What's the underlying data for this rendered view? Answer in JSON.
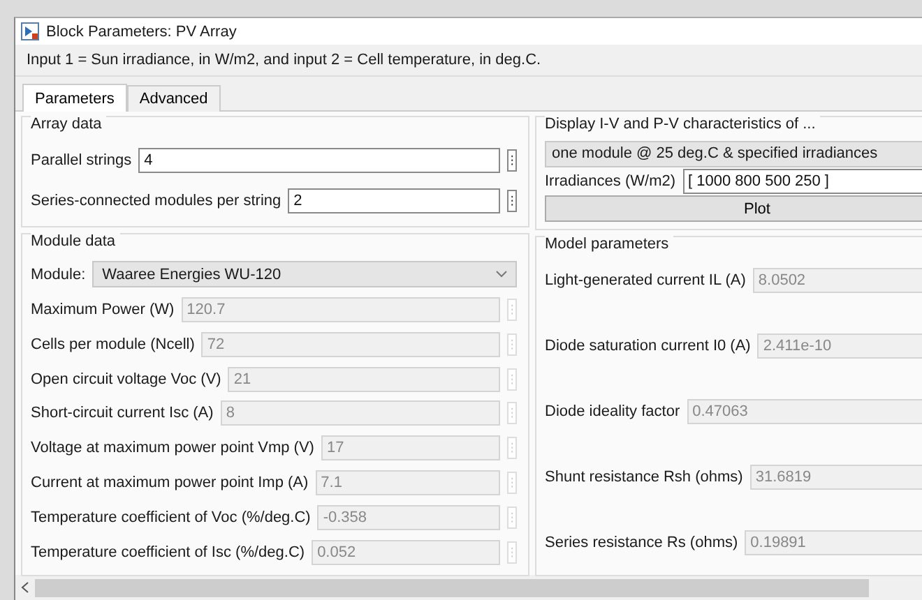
{
  "window": {
    "title": "Block Parameters: PV Array"
  },
  "description": "Input 1 = Sun irradiance, in W/m2, and input 2 = Cell temperature, in deg.C.",
  "tabs": [
    {
      "label": "Parameters",
      "selected": true
    },
    {
      "label": "Advanced",
      "selected": false
    }
  ],
  "array_data": {
    "title": "Array data",
    "fields": [
      {
        "label": "Parallel strings",
        "value": "4",
        "disabled": false
      },
      {
        "label": "Series-connected modules per string",
        "value": "2",
        "disabled": false
      }
    ]
  },
  "module_data": {
    "title": "Module data",
    "module": {
      "label": "Module:",
      "value": "Waaree Energies WU-120"
    },
    "fields": [
      {
        "label": "Maximum Power (W)",
        "value": "120.7",
        "disabled": true
      },
      {
        "label": "Cells per module (Ncell)",
        "value": "72",
        "disabled": true
      },
      {
        "label": "Open circuit voltage  Voc (V)",
        "value": "21",
        "disabled": true
      },
      {
        "label": "Short-circuit current Isc (A)",
        "value": "8",
        "disabled": true
      },
      {
        "label": "Voltage at maximum power point Vmp (V)",
        "value": "17",
        "disabled": true
      },
      {
        "label": "Current at maximum power point Imp (A)",
        "value": "7.1",
        "disabled": true
      },
      {
        "label": "Temperature coefficient of Voc (%/deg.C)",
        "value": "-0.358",
        "disabled": true
      },
      {
        "label": "Temperature coefficient of Isc (%/deg.C)",
        "value": "0.052",
        "disabled": true
      }
    ]
  },
  "display": {
    "title": "Display  I-V and P-V characteristics of ...",
    "mode": "one module @ 25 deg.C & specified irradiances",
    "irradiances": {
      "label": "Irradiances (W/m2)",
      "value": "[ 1000 800 500  250 ]"
    },
    "plot_button": "Plot"
  },
  "model_parameters": {
    "title": "Model parameters",
    "fields": [
      {
        "label": "Light-generated current IL (A)",
        "value": "8.0502",
        "disabled": true
      },
      {
        "label": "Diode saturation current I0 (A)",
        "value": "2.411e-10",
        "disabled": true
      },
      {
        "label": "Diode ideality factor",
        "value": "0.47063",
        "disabled": true
      },
      {
        "label": "Shunt resistance Rsh (ohms)",
        "value": "31.6819",
        "disabled": true
      },
      {
        "label": "Series resistance Rs (ohms)",
        "value": "0.19891",
        "disabled": true
      }
    ]
  }
}
